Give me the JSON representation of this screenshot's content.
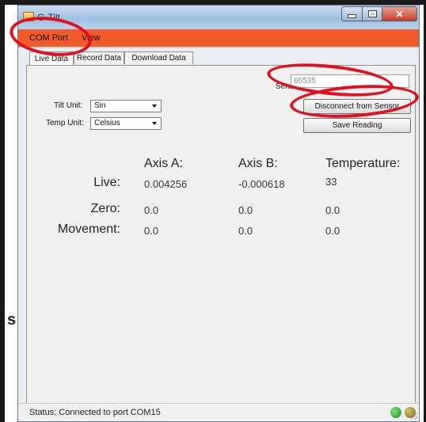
{
  "window": {
    "title": "G-Tilt"
  },
  "menu": {
    "items": [
      "COM Port",
      "View"
    ]
  },
  "tabs": [
    "Live Data",
    "Record Data",
    "Download Data"
  ],
  "settings": {
    "tilt_unit_label": "Tilt Unit:",
    "tilt_unit_value": "Sin",
    "temp_unit_label": "Temp Unit:",
    "temp_unit_value": "Celsius"
  },
  "sensor": {
    "label": "Sensor",
    "value": "65535",
    "disconnect_label": "Disconnect from Sensor",
    "save_label": "Save Reading"
  },
  "readings": {
    "columns": [
      "Axis A:",
      "Axis B:",
      "Temperature:"
    ],
    "rows": [
      {
        "label": "Live:",
        "values": [
          "0.004256",
          "-0.000618",
          "33"
        ]
      },
      {
        "label": "Zero:",
        "values": [
          "0.0",
          "0.0",
          "0.0"
        ]
      },
      {
        "label": "Movement:",
        "values": [
          "0.0",
          "0.0",
          "0.0"
        ]
      }
    ]
  },
  "status": {
    "text": "Status: Connected to port COM15"
  },
  "outside_text": "s",
  "colors": {
    "menubar": "#f25a2a",
    "annotation": "#e0101e",
    "led_green": "#1f8f1f",
    "led_olive": "#7a6312"
  }
}
